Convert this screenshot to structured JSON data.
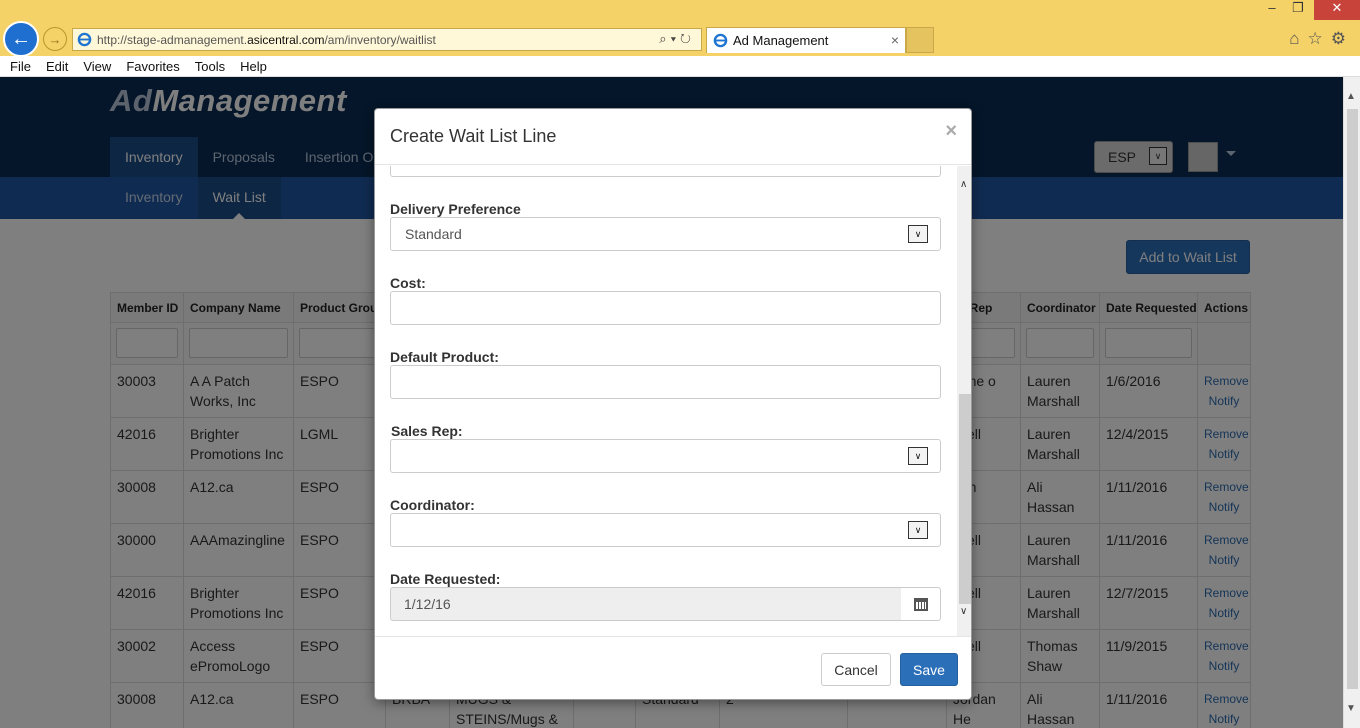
{
  "browser": {
    "url_prefix": "http://stage-admanagement.",
    "url_domain": "asicentral.com",
    "url_suffix": "/am/inventory/waitlist",
    "tab_title": "Ad Management",
    "tab_close": "×",
    "menu": [
      "File",
      "Edit",
      "View",
      "Favorites",
      "Tools",
      "Help"
    ]
  },
  "app": {
    "brand_light": "Ad",
    "brand_bold": "Management",
    "main_nav": [
      "Inventory",
      "Proposals",
      "Insertion O"
    ],
    "sub_nav": [
      "Inventory",
      "Wait List"
    ],
    "esp_label": "ESP",
    "add_button": "Add to Wait List"
  },
  "table": {
    "columns": [
      "Member ID",
      "Company Name",
      "Product Group",
      "",
      "",
      "",
      "",
      "",
      "",
      "es Rep",
      "Coordinator",
      "Date Requested",
      "Actions"
    ],
    "rows": [
      [
        "30003",
        "A A Patch Works, Inc",
        "ESPO",
        "",
        "",
        "",
        "",
        "",
        "",
        "anne o",
        "Lauren Marshall",
        "1/6/2016"
      ],
      [
        "42016",
        "Brighter Promotions Inc",
        "LGML",
        "",
        "",
        "",
        "",
        "",
        "",
        "is ell",
        "Lauren Marshall",
        "12/4/2015"
      ],
      [
        "30008",
        "A12.ca",
        "ESPO",
        "",
        "",
        "",
        "",
        "",
        "",
        "dan",
        "Ali Hassan",
        "1/11/2016"
      ],
      [
        "30000",
        "AAAmazingline",
        "ESPO",
        "",
        "",
        "",
        "",
        "",
        "",
        "is ell",
        "Lauren Marshall",
        "1/11/2016"
      ],
      [
        "42016",
        "Brighter Promotions Inc",
        "ESPO",
        "",
        "",
        "",
        "",
        "",
        "",
        "is ell",
        "Lauren Marshall",
        "12/7/2015"
      ],
      [
        "30002",
        "Access ePromoLogo",
        "ESPO",
        "",
        "",
        "",
        "",
        "",
        "",
        "is ell",
        "Thomas Shaw",
        "11/9/2015"
      ],
      [
        "30008",
        "A12.ca",
        "ESPO",
        "BRBA",
        "MUGS & STEINS/Mugs &",
        "",
        "Standard",
        "2",
        "",
        "Jordan He",
        "Ali Hassan",
        "1/11/2016"
      ]
    ],
    "action_remove": "Remove",
    "action_notify": "Notify"
  },
  "modal": {
    "title": "Create Wait List Line",
    "close": "×",
    "delivery_label": "Delivery Preference",
    "delivery_value": "Standard",
    "cost_label": "Cost:",
    "cost_value": "",
    "default_product_label": "Default Product:",
    "default_product_value": "",
    "sales_rep_label": "Sales Rep:",
    "sales_rep_value": "",
    "coordinator_label": "Coordinator:",
    "coordinator_value": "",
    "date_label": "Date Requested:",
    "date_value": "1/12/16",
    "cancel": "Cancel",
    "save": "Save"
  }
}
